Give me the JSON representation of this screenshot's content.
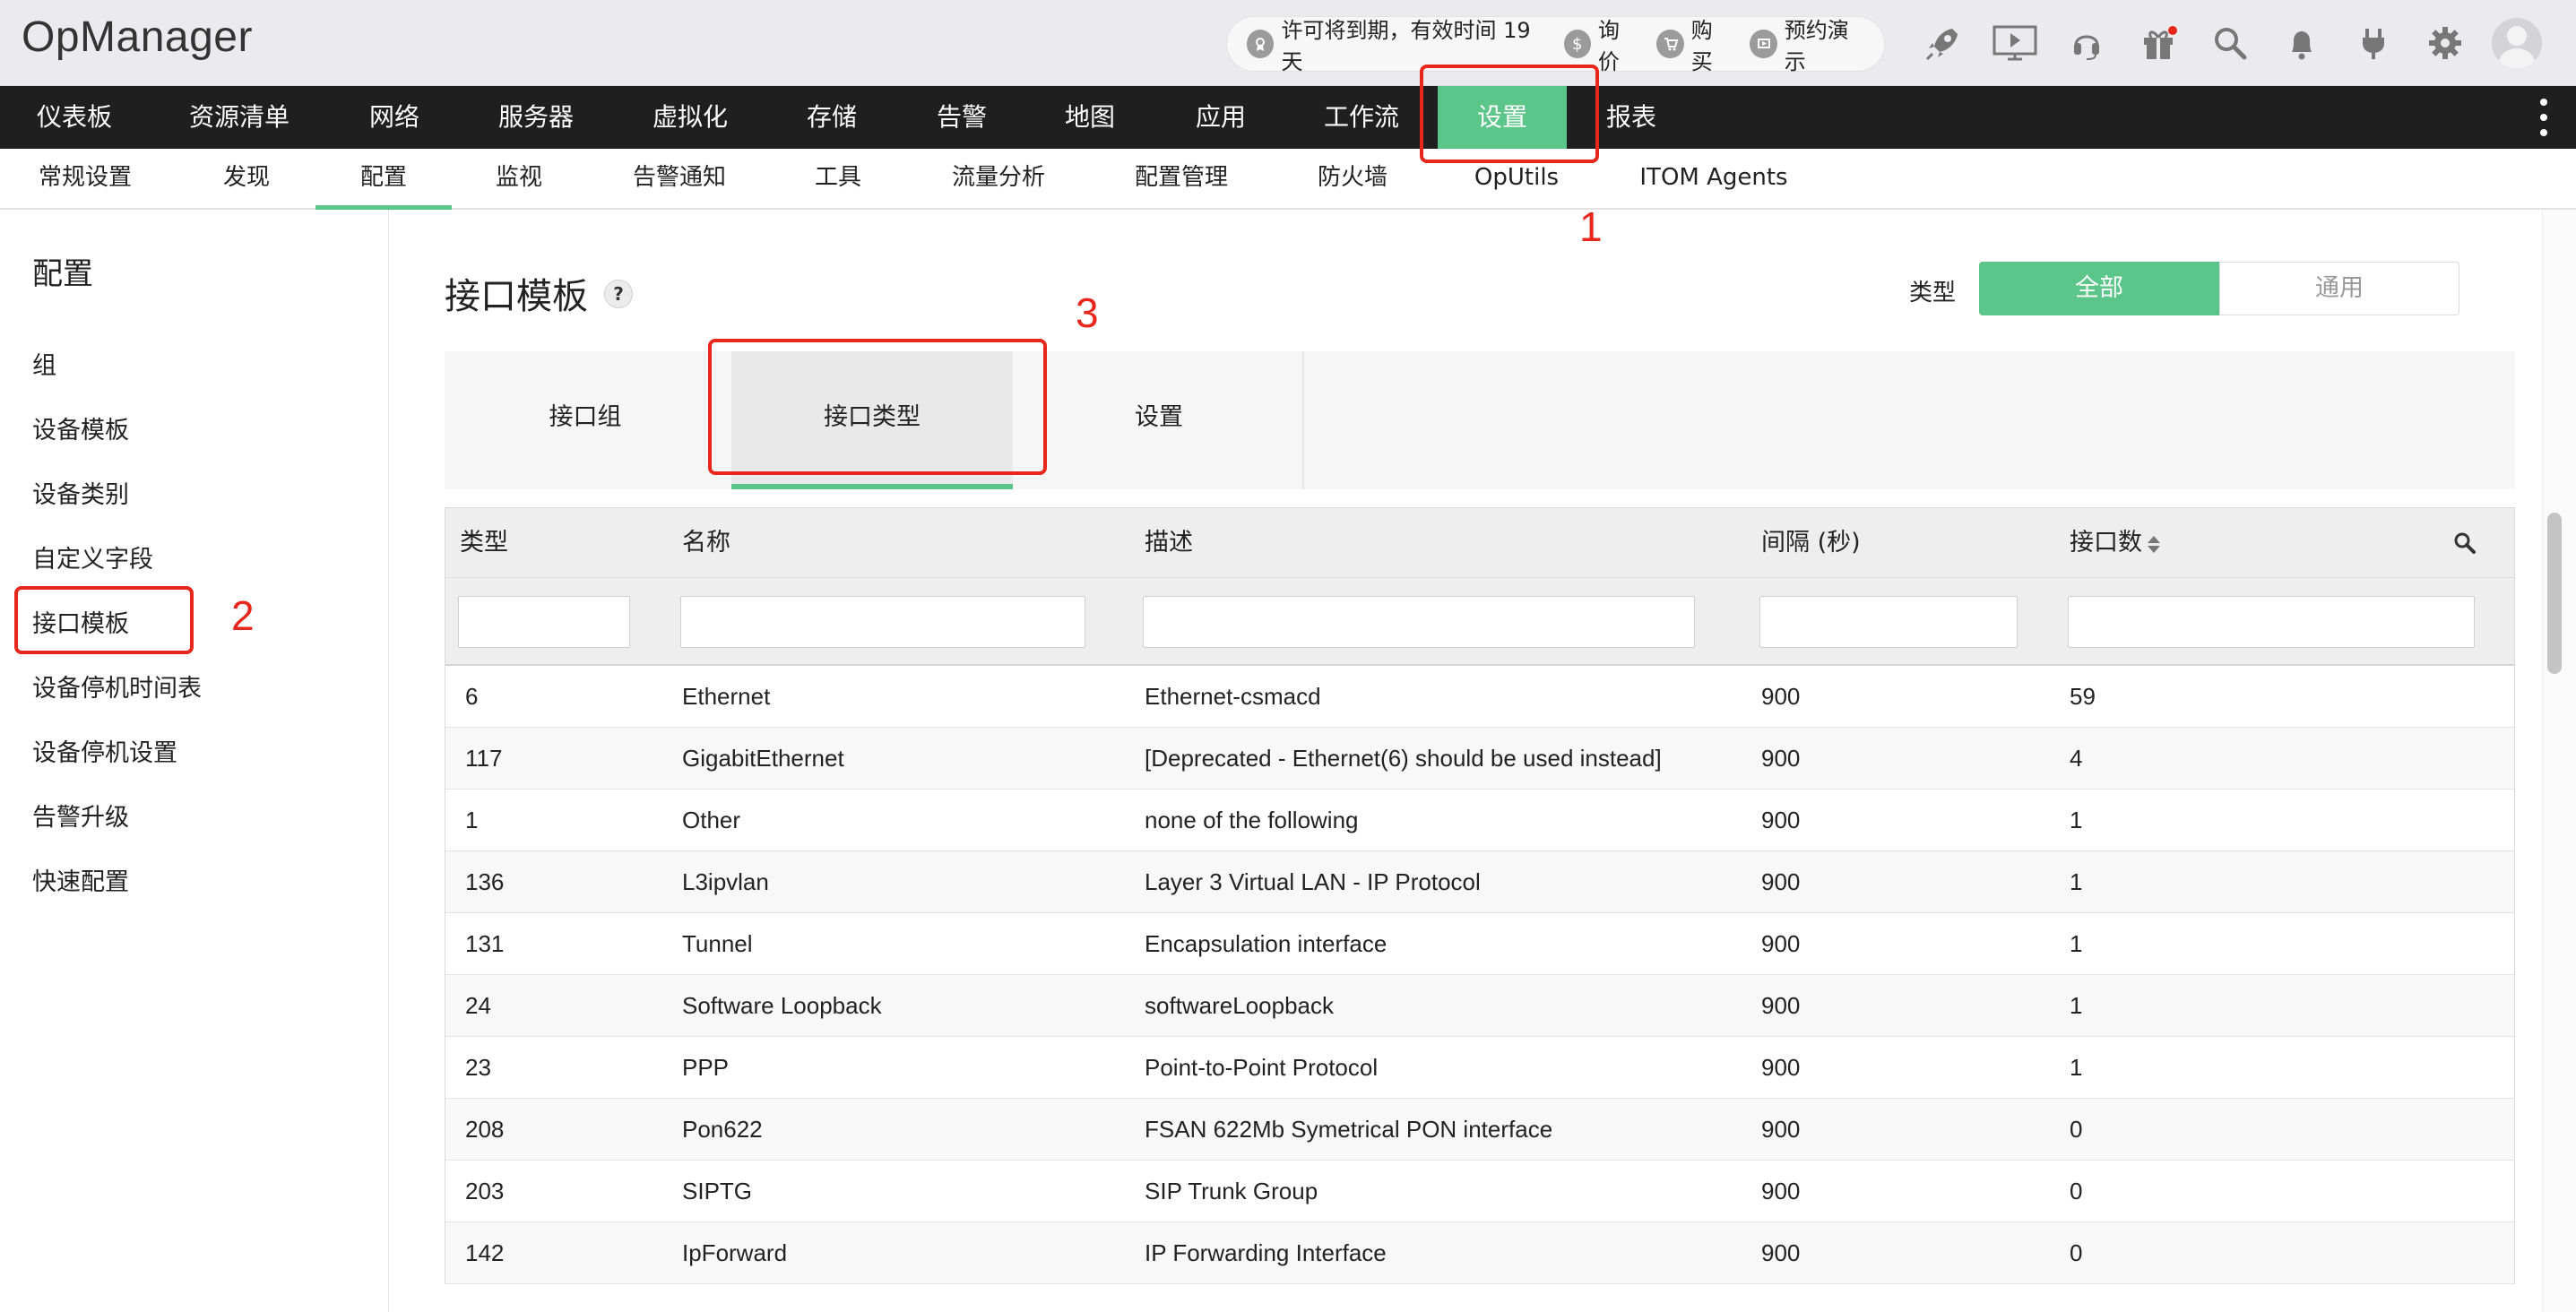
{
  "app": {
    "name": "OpManager"
  },
  "license": {
    "expiry_text": "许可将到期，有效时间 19 天",
    "quote": "询价",
    "buy": "购买",
    "demo": "预约演示"
  },
  "main_nav": {
    "items": [
      {
        "label": "仪表板"
      },
      {
        "label": "资源清单"
      },
      {
        "label": "网络"
      },
      {
        "label": "服务器"
      },
      {
        "label": "虚拟化"
      },
      {
        "label": "存储"
      },
      {
        "label": "告警"
      },
      {
        "label": "地图"
      },
      {
        "label": "应用"
      },
      {
        "label": "工作流"
      },
      {
        "label": "设置",
        "active": true
      },
      {
        "label": "报表"
      }
    ]
  },
  "sub_nav": {
    "items": [
      {
        "label": "常规设置"
      },
      {
        "label": "发现"
      },
      {
        "label": "配置",
        "active": true
      },
      {
        "label": "监视"
      },
      {
        "label": "告警通知"
      },
      {
        "label": "工具"
      },
      {
        "label": "流量分析"
      },
      {
        "label": "配置管理"
      },
      {
        "label": "防火墙"
      },
      {
        "label": "OpUtils"
      },
      {
        "label": "ITOM Agents"
      }
    ]
  },
  "sidebar": {
    "title": "配置",
    "items": [
      {
        "label": "组"
      },
      {
        "label": "设备模板"
      },
      {
        "label": "设备类别"
      },
      {
        "label": "自定义字段"
      },
      {
        "label": "接口模板",
        "active": true
      },
      {
        "label": "设备停机时间表"
      },
      {
        "label": "设备停机设置"
      },
      {
        "label": "告警升级"
      },
      {
        "label": "快速配置"
      }
    ]
  },
  "page": {
    "title": "接口模板",
    "help": "?",
    "type_label": "类型",
    "segments": {
      "all": "全部",
      "general": "通用"
    },
    "tabs": [
      {
        "label": "接口组"
      },
      {
        "label": "接口类型",
        "active": true
      },
      {
        "label": "设置"
      }
    ]
  },
  "table": {
    "columns": [
      "类型",
      "名称",
      "描述",
      "间隔 (秒)",
      "接口数"
    ],
    "rows": [
      [
        "6",
        "Ethernet",
        "Ethernet-csmacd",
        "900",
        "59"
      ],
      [
        "117",
        "GigabitEthernet",
        "[Deprecated - Ethernet(6) should be used instead]",
        "900",
        "4"
      ],
      [
        "1",
        "Other",
        "none of the following",
        "900",
        "1"
      ],
      [
        "136",
        "L3ipvlan",
        "Layer 3 Virtual LAN - IP Protocol",
        "900",
        "1"
      ],
      [
        "131",
        "Tunnel",
        "Encapsulation interface",
        "900",
        "1"
      ],
      [
        "24",
        "Software Loopback",
        "softwareLoopback",
        "900",
        "1"
      ],
      [
        "23",
        "PPP",
        "Point-to-Point Protocol",
        "900",
        "1"
      ],
      [
        "208",
        "Pon622",
        "FSAN 622Mb Symetrical PON interface",
        "900",
        "0"
      ],
      [
        "203",
        "SIPTG",
        "SIP Trunk Group",
        "900",
        "0"
      ],
      [
        "142",
        "IpForward",
        "IP Forwarding Interface",
        "900",
        "0"
      ]
    ]
  },
  "annotations": {
    "n1": "1",
    "n2": "2",
    "n3": "3"
  },
  "colors": {
    "accent": "#5bc58a",
    "nav_bg": "#1f1f1f",
    "annotation": "#e8261c"
  }
}
